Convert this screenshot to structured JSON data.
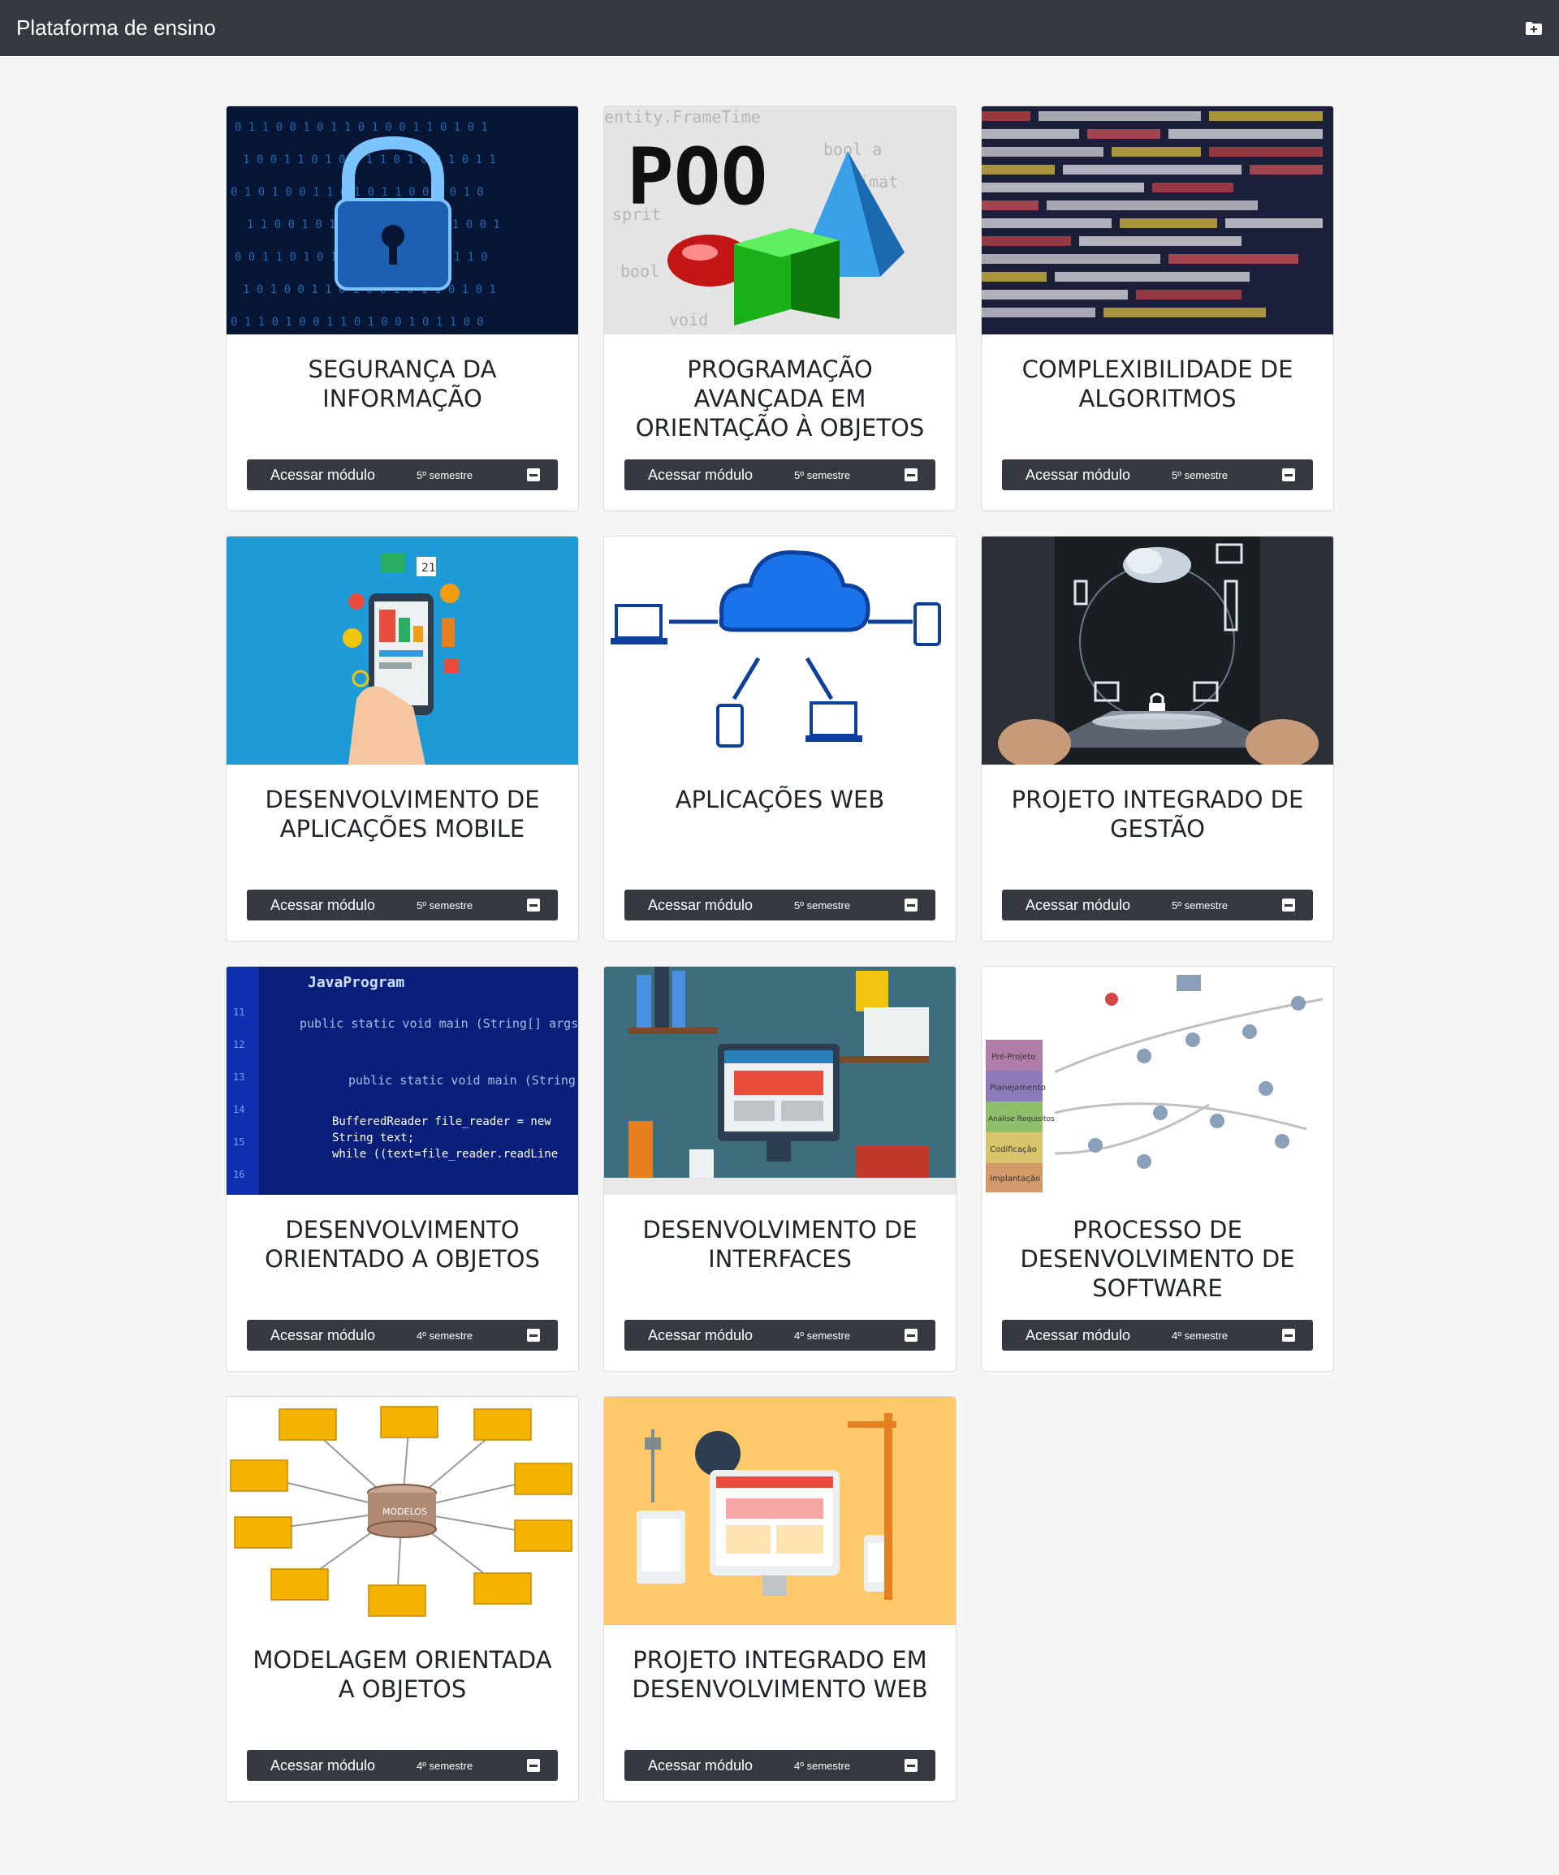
{
  "navbar": {
    "brand": "Plataforma de ensino",
    "icon": "folder-plus-icon"
  },
  "theme": {
    "navbar_bg": "#343a40",
    "page_bg": "#f5f5f5",
    "button_bg": "#343a40"
  },
  "cards": [
    {
      "title": "SEGURANÇA DA INFORMAÇÃO",
      "button_label": "Acessar módulo",
      "semester": "5º semestre",
      "image": "padlock-binary-image"
    },
    {
      "title": "PROGRAMAÇÃO AVANÇADA EM ORIENTAÇÃO À OBJETOS",
      "button_label": "Acessar módulo",
      "semester": "5º semestre",
      "image": "poo-shapes-image",
      "image_text": "POO"
    },
    {
      "title": "COMPLEXIBILIDADE DE ALGORITMOS",
      "button_label": "Acessar módulo",
      "semester": "5º semestre",
      "image": "code-screen-image"
    },
    {
      "title": "DESENVOLVIMENTO DE APLICAÇÕES MOBILE",
      "button_label": "Acessar módulo",
      "semester": "5º semestre",
      "image": "mobile-apps-image",
      "image_text": "21"
    },
    {
      "title": "APLICAÇÕES WEB",
      "button_label": "Acessar módulo",
      "semester": "5º semestre",
      "image": "cloud-network-image"
    },
    {
      "title": "PROJETO INTEGRADO DE GESTÃO",
      "button_label": "Acessar módulo",
      "semester": "5º semestre",
      "image": "cloud-tablet-image"
    },
    {
      "title": "DESENVOLVIMENTO ORIENTADO A OBJETOS",
      "button_label": "Acessar módulo",
      "semester": "4º semestre",
      "image": "java-code-image",
      "image_text": "JavaProgram"
    },
    {
      "title": "DESENVOLVIMENTO DE INTERFACES",
      "button_label": "Acessar módulo",
      "semester": "4º semestre",
      "image": "desk-monitor-image"
    },
    {
      "title": "PROCESSO DE DESENVOLVIMENTO DE SOFTWARE",
      "button_label": "Acessar módulo",
      "semester": "4º semestre",
      "image": "process-diagram-image",
      "image_labels": [
        "Pré-Projeto",
        "Planejamento",
        "Análise Requisitos",
        "Codificação",
        "Implantação"
      ]
    },
    {
      "title": "MODELAGEM ORIENTADA A OBJETOS",
      "button_label": "Acessar módulo",
      "semester": "4º semestre",
      "image": "uml-diagram-image",
      "image_text": "MODELOS"
    },
    {
      "title": "PROJETO INTEGRADO EM DESENVOLVIMENTO WEB",
      "button_label": "Acessar módulo",
      "semester": "4º semestre",
      "image": "web-devices-image"
    }
  ]
}
